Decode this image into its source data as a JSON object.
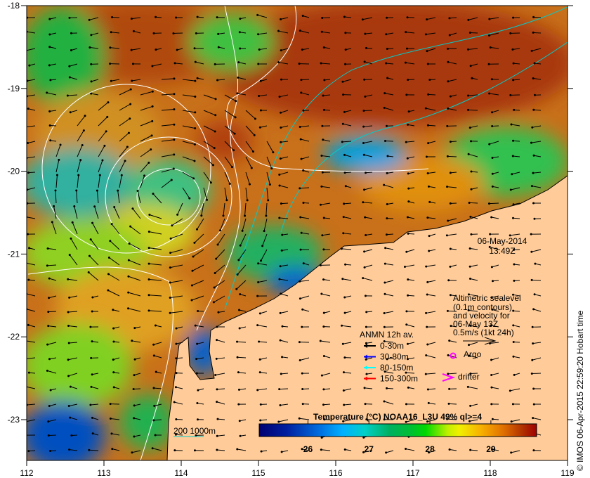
{
  "map": {
    "lon_ticks": [
      "112",
      "113",
      "114",
      "115",
      "116",
      "117",
      "118",
      "119"
    ],
    "lat_ticks": [
      "-18",
      "-19",
      "-20",
      "-21",
      "-22",
      "-23"
    ],
    "lon_range": [
      112,
      119
    ],
    "lat_range": [
      -23.5,
      -18
    ]
  },
  "timestamp": {
    "date": "06-May-2014",
    "time": "13:49Z"
  },
  "altimetry_note": {
    "lines": [
      "Altimetric sealevel",
      "(0.1m contours)",
      "and velocity for",
      "06-May 13Z",
      "0.5m/s (1kt 24h)"
    ]
  },
  "anmn_legend": {
    "title": "ANMN 12h av.",
    "items": [
      {
        "label": "0-30m",
        "color": "#000000"
      },
      {
        "label": "30-80m",
        "color": "#0000ff"
      },
      {
        "label": "80-150m",
        "color": "#00ffff"
      },
      {
        "label": "150-300m",
        "color": "#ff0000"
      }
    ]
  },
  "markers": {
    "argo": "Argo",
    "drifter": "drifter",
    "marker_color": "#ff00ff"
  },
  "bathymetry_label": "200  1000m",
  "colorbar": {
    "title": "Temperature (°C) NOAA16_L3U 49% ql>=4",
    "ticks": [
      "26",
      "27",
      "28",
      "29"
    ],
    "range": [
      25.2,
      29.75
    ]
  },
  "credit": "© IMOS 06-Apr-2015 22:59:20 Hobart time",
  "colors": {
    "land": "#ffcc99",
    "contour": "#ffffff",
    "isobath": "#00cccc"
  }
}
